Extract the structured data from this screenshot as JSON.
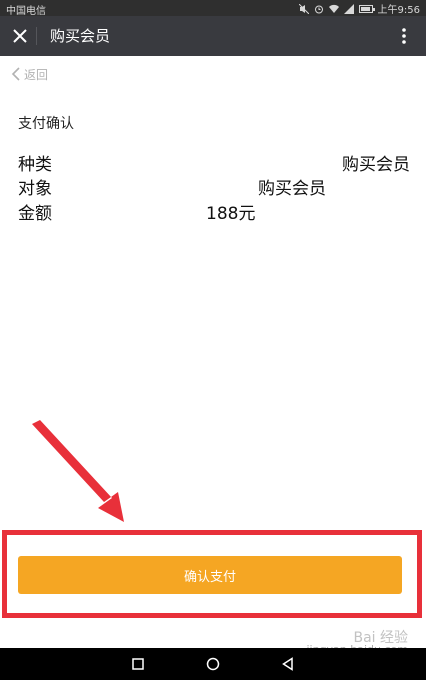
{
  "status_bar": {
    "carrier": "中国电信",
    "time": "上午9:56"
  },
  "nav_bar": {
    "title": "购买会员"
  },
  "back": {
    "label": "返回"
  },
  "section_title": "支付确认",
  "details": [
    {
      "label": "种类",
      "value": "购买会员"
    },
    {
      "label": "对象",
      "value": "购买会员"
    },
    {
      "label": "金额",
      "value": "188元"
    }
  ],
  "pay_button": {
    "label": "确认支付",
    "color": "#f5a623"
  },
  "annotation": {
    "color": "#e8303a"
  },
  "watermark": {
    "brand": "Bai 经验",
    "url": "jingyan.baidu.com"
  }
}
